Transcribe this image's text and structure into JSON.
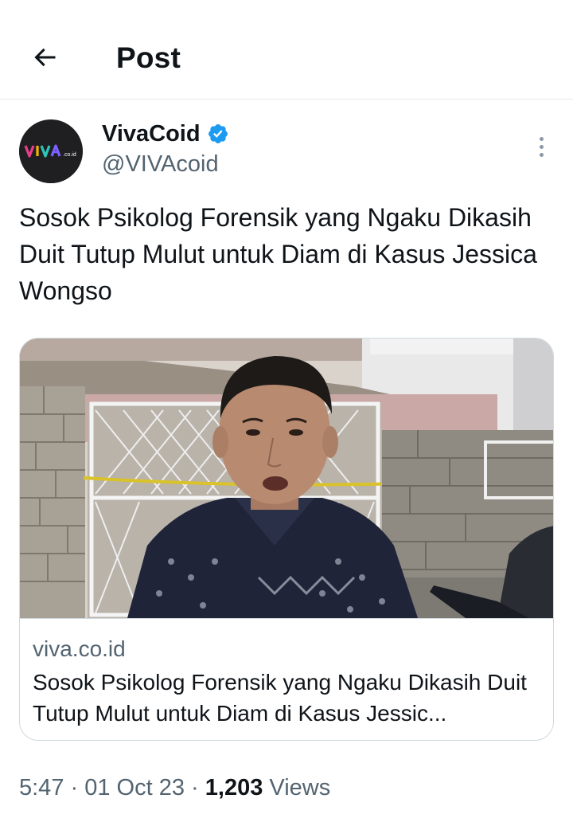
{
  "header": {
    "title": "Post",
    "back_icon": "arrow-left-icon"
  },
  "author": {
    "display_name": "VivaCoid",
    "handle": "@VIVAcoid",
    "verified": true,
    "verified_color": "#1d9bf0",
    "avatar_logo_text": "VIVA",
    "avatar_logo_suffix": ".co.id"
  },
  "tweet": {
    "text": "Sosok Psikolog Forensik yang Ngaku Dikasih Duit Tutup Mulut untuk Diam di Kasus Jessica Wongso"
  },
  "card": {
    "image_description": "photo",
    "domain": "viva.co.id",
    "title": "Sosok Psikolog Forensik yang Ngaku Dikasih Duit Tutup Mulut untuk Diam di Kasus Jessic..."
  },
  "meta": {
    "time": "5:47",
    "separator": " · ",
    "date": "01 Oct 23",
    "views_count": "1,203",
    "views_label": " Views"
  },
  "colors": {
    "text_primary": "#0f1419",
    "text_secondary": "#536471",
    "border": "#cfd9de",
    "accent": "#1d9bf0"
  }
}
